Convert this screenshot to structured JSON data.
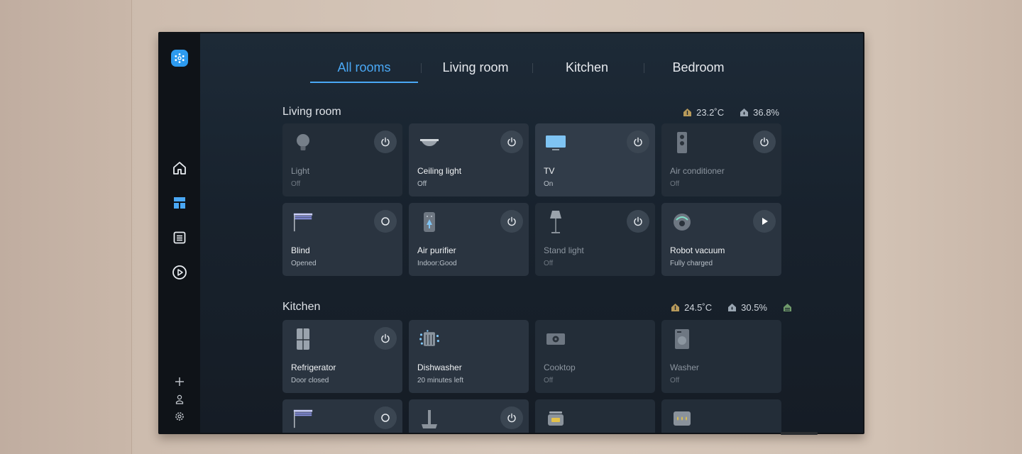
{
  "tabs": [
    "All rooms",
    "Living room",
    "Kitchen",
    "Bedroom"
  ],
  "colors": {
    "accent": "#4aa8f5",
    "card": "#2a3440",
    "card_dim": "#232d38",
    "sidebar": "#0f1318"
  },
  "sidebar": {
    "logo_icon": "smartthings-logo-icon",
    "items": [
      "home-icon",
      "dashboard-icon",
      "list-icon",
      "play-icon"
    ],
    "bottom": [
      "add-icon",
      "person-icon",
      "settings-icon"
    ]
  },
  "living": {
    "title": "Living room",
    "temp": "23.2˚C",
    "humidity": "36.8%",
    "cards": [
      {
        "name": "Light",
        "status": "Off"
      },
      {
        "name": "Ceiling light",
        "status": "Off"
      },
      {
        "name": "TV",
        "status": "On"
      },
      {
        "name": "Air conditioner",
        "status": "Off"
      },
      {
        "name": "Blind",
        "status": "Opened"
      },
      {
        "name": "Air purifier",
        "status": "Indoor:Good"
      },
      {
        "name": "Stand light",
        "status": "Off"
      },
      {
        "name": "Robot vacuum",
        "status": "Fully charged"
      }
    ]
  },
  "kitchen": {
    "title": "Kitchen",
    "temp": "24.5˚C",
    "humidity": "30.5%",
    "cards": [
      {
        "name": "Refrigerator",
        "status": "Door closed"
      },
      {
        "name": "Dishwasher",
        "status": "20 minutes left"
      },
      {
        "name": "Cooktop",
        "status": "Off"
      },
      {
        "name": "Washer",
        "status": "Off"
      }
    ]
  }
}
